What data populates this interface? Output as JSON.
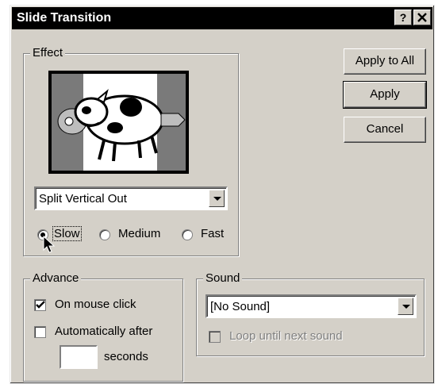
{
  "dialog": {
    "title": "Slide Transition",
    "help_label": "?",
    "close_label": "✕"
  },
  "effect": {
    "legend": "Effect",
    "select_value": "Split Vertical Out",
    "speed": {
      "slow": "Slow",
      "medium": "Medium",
      "fast": "Fast",
      "selected": "slow"
    }
  },
  "buttons": {
    "apply_to_all": "Apply to All",
    "apply": "Apply",
    "cancel": "Cancel"
  },
  "advance": {
    "legend": "Advance",
    "on_mouse_click": "On mouse click",
    "on_mouse_click_checked": true,
    "automatically_after": "Automatically after",
    "automatically_checked": false,
    "seconds_value": "",
    "seconds_label": "seconds"
  },
  "sound": {
    "legend": "Sound",
    "select_value": "[No Sound]",
    "loop_label": "Loop until next sound",
    "loop_checked": false
  }
}
